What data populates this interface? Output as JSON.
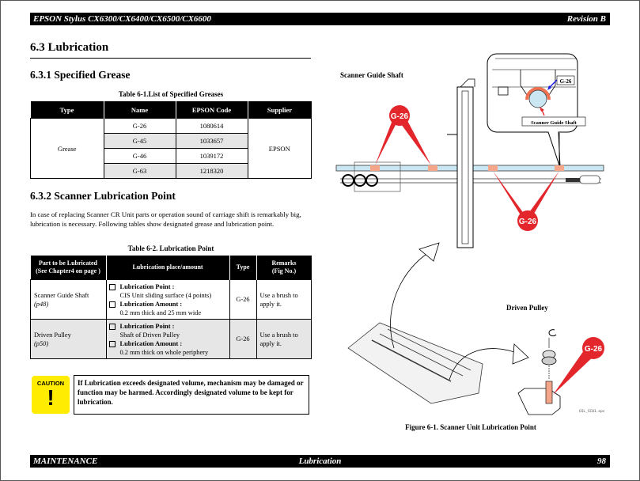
{
  "header": {
    "model": "EPSON Stylus CX6300/CX6400/CX6500/CX6600",
    "revision": "Revision B"
  },
  "footer": {
    "chapter": "MAINTENANCE",
    "section": "Lubrication",
    "page": "98"
  },
  "section": {
    "title": "6.3  Lubrication"
  },
  "sub1": {
    "title": "6.3.1  Specified Grease",
    "table_caption": "Table 6-1.List of Specified Greases",
    "columns": [
      "Type",
      "Name",
      "EPSON Code",
      "Supplier"
    ],
    "type_value": "Grease",
    "supplier_value": "EPSON",
    "rows": [
      {
        "name": "G-26",
        "code": "1080614"
      },
      {
        "name": "G-45",
        "code": "1033657"
      },
      {
        "name": "G-46",
        "code": "1039172"
      },
      {
        "name": "G-63",
        "code": "1218320"
      }
    ]
  },
  "sub2": {
    "title": "6.3.2  Scanner Lubrication Point",
    "paragraph": "In case of replacing Scanner CR Unit parts or operation sound of carriage shift is remarkably big, lubrication is necessary. Following tables show designated grease and lubrication point.",
    "table_caption": "Table 6-2. Lubrication Point",
    "columns": {
      "part_line1": "Part to be Lubricated",
      "part_line2": "(See Chapter4 on page )",
      "place": "Lubrication place/amount",
      "type": "Type",
      "remarks_line1": "Remarks",
      "remarks_line2": "(Fig No.)"
    },
    "rows": [
      {
        "part": "Scanner Guide Shaft",
        "page": "(p48)",
        "point_label": "Lubrication Point :",
        "point_value": "CIS Unit sliding surface (4 points)",
        "amount_label": "Lubrication Amount :",
        "amount_value": "0.2 mm thick and 25 mm wide",
        "type": "G-26",
        "remarks": "Use a brush to apply it."
      },
      {
        "part": "Driven Pulley",
        "page": "(p50)",
        "point_label": "Lubrication Point :",
        "point_value": "Shaft of Driven Pulley",
        "amount_label": "Lubrication Amount :",
        "amount_value": "0.2 mm thick on whole periphery",
        "type": "G-26",
        "remarks": "Use a brush to apply it."
      }
    ]
  },
  "caution": {
    "icon_label": "CAUTION",
    "icon_symbol": "!",
    "text": "If Lubrication exceeds designated volume, mechanism may be damaged or function may be harmed. Accordingly designated volume to be kept for lubrication."
  },
  "figure": {
    "label_guide_shaft": "Scanner Guide Shaft",
    "label_driven_pulley": "Driven Pulley",
    "callout_grease": "G-26",
    "detail_grease": "G-26",
    "detail_shaft": "Scanner Guide Shaft",
    "caption": "Figure 6-1. Scanner Unit Lubrication Point",
    "filename": "OIL_SC01.eps",
    "colors": {
      "callout": "#e3262b",
      "grease": "#f4a58a",
      "shaft": "#c9e6f2",
      "caution": "#ffec00"
    }
  }
}
